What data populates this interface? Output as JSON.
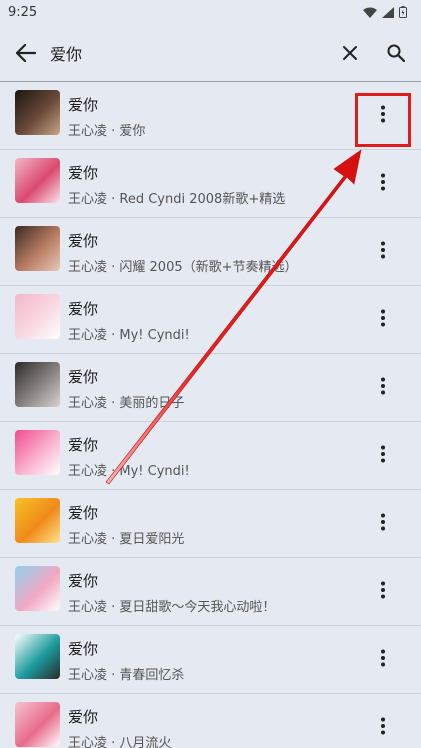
{
  "status_bar": {
    "time": "9:25"
  },
  "search": {
    "query": "爱你"
  },
  "songs": [
    {
      "title": "爱你",
      "subtitle": "王心凌 · 爱你",
      "cover_colors": [
        "#1a1613",
        "#6b4a3a",
        "#c8a58a"
      ]
    },
    {
      "title": "爱你",
      "subtitle": "王心凌 · Red Cyndi 2008新歌+精选",
      "cover_colors": [
        "#f4b7c9",
        "#d9496e",
        "#fbe3ea"
      ]
    },
    {
      "title": "爱你",
      "subtitle": "王心凌 · 闪耀 2005（新歌+节奏精选）",
      "cover_colors": [
        "#3b2a24",
        "#b87d63",
        "#e7c9b6"
      ]
    },
    {
      "title": "爱你",
      "subtitle": "王心凌 · My! Cyndi!",
      "cover_colors": [
        "#f5b6c8",
        "#f9d9e2",
        "#ffffff"
      ]
    },
    {
      "title": "爱你",
      "subtitle": "王心凌 · 美丽的日子",
      "cover_colors": [
        "#2c2a2a",
        "#8a8583",
        "#d9d3cf"
      ]
    },
    {
      "title": "爱你",
      "subtitle": "王心凌 · My! Cyndi!",
      "cover_colors": [
        "#f04c8c",
        "#f9b3cf",
        "#ffffff"
      ]
    },
    {
      "title": "爱你",
      "subtitle": "王心凌 · 夏日爱阳光",
      "cover_colors": [
        "#f6c225",
        "#f08a1a",
        "#fde48a"
      ]
    },
    {
      "title": "爱你",
      "subtitle": "王心凌 · 夏日甜歌～今天我心动啦！",
      "cover_colors": [
        "#8fd2ef",
        "#f1a7c3",
        "#ffffff"
      ]
    },
    {
      "title": "爱你",
      "subtitle": "王心凌 · 青春回忆杀",
      "cover_colors": [
        "#ffffff",
        "#1b9b9e",
        "#2a2a2a"
      ]
    },
    {
      "title": "爱你",
      "subtitle": "王心凌 · 八月流火",
      "cover_colors": [
        "#f5c3d1",
        "#e86c8a",
        "#ffffff"
      ]
    }
  ],
  "colors": {
    "highlight": "#e01b1b",
    "arrow": "#e01b1b"
  }
}
